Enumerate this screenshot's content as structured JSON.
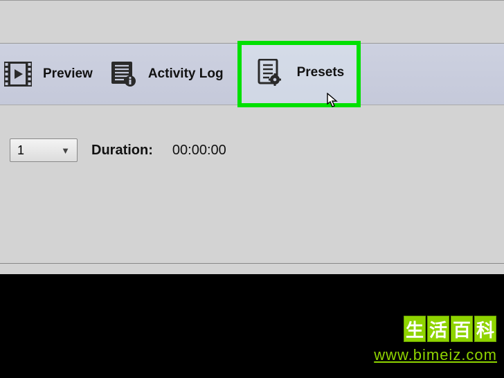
{
  "tabs": {
    "preview": {
      "label": "Preview"
    },
    "activity_log": {
      "label": "Activity Log"
    },
    "presets": {
      "label": "Presets"
    }
  },
  "dropdown": {
    "value": "1"
  },
  "duration": {
    "label": "Duration:",
    "value": "00:00:00"
  },
  "watermark": {
    "chars": [
      "生",
      "活",
      "百",
      "科"
    ],
    "url": "www.bimeiz.com"
  }
}
